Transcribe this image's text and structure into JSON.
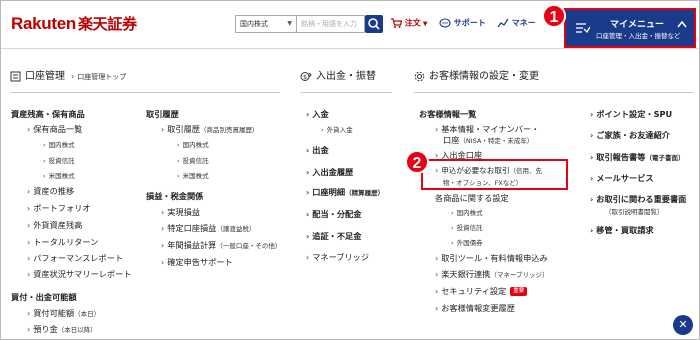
{
  "header": {
    "logo_en": "Rakuten",
    "logo_jp": "楽天証券",
    "market_select": "国内株式",
    "search_placeholder": "銘柄・用語を入力",
    "cart_label": "注文",
    "support_label": "サポート",
    "manual_label": "マネー",
    "mymenu_title": "マイメニュー",
    "mymenu_sub": "口座管理・入出金・振替など"
  },
  "badges": {
    "one": "1",
    "two": "2"
  },
  "sections": {
    "account": {
      "title": "口座管理",
      "sub": "口座管理トップ"
    },
    "deposit": {
      "title": "入出金・振替"
    },
    "customer": {
      "title": "お客様情報の設定・変更"
    }
  },
  "col1": {
    "h1": "資産残高・保有商品",
    "i1": "保有商品一覧",
    "i1a": "国内株式",
    "i1b": "投資信託",
    "i1c": "米国株式",
    "i2": "資産の推移",
    "i3": "ポートフォリオ",
    "i4": "外貨資産残高",
    "i5": "トータルリターン",
    "i6": "パフォーマンスレポート",
    "i7": "資産状況サマリーレポート",
    "h2": "買付・出金可能額",
    "i8": "買付可能額",
    "i8s": "（本日）",
    "i9": "預り金",
    "i9s": "（本日以降）"
  },
  "col2": {
    "h1": "取引履歴",
    "i1": "取引履歴",
    "i1s": "（商品別売買履歴）",
    "i1a": "国内株式",
    "i1b": "投資信託",
    "i1c": "米国株式",
    "h2": "損益・税金関係",
    "i2": "実現損益",
    "i3": "特定口座損益",
    "i3s": "（譲渡益税）",
    "i4": "年間損益計算",
    "i4s": "（一般口座・その他）",
    "i5": "確定申告サポート"
  },
  "col3": {
    "i1": "入金",
    "i1a": "外貨入金",
    "i2": "出金",
    "i3": "入出金履歴",
    "i4": "口座明細",
    "i4s": "（精算履歴）",
    "i5": "配当・分配金",
    "i6": "追証・不足金",
    "i7": "マネーブリッジ"
  },
  "col4": {
    "h1": "お客様情報一覧",
    "i1": "基本情報・マイナンバー・",
    "i1b": "口座",
    "i1s": "（NISA・特定・未成年）",
    "i2": "入出金口座",
    "i3": "申込が必要なお取引",
    "i3s": "（信用、先",
    "i3s2": "物・オプション、FXなど）",
    "i4": "各商品に関する設定",
    "i4a": "国内株式",
    "i4b": "投資信託",
    "i4c": "外国債券",
    "i5": "取引ツール・有料情報申込み",
    "i6": "楽天銀行連携",
    "i6s": "（マネーブリッジ）",
    "i7": "セキュリティ設定",
    "i7tag": "重要",
    "i8": "お客様情報変更履歴"
  },
  "col5": {
    "i1": "ポイント設定・SPU",
    "i2": "ご家族・お友達紹介",
    "i3": "取引報告書等",
    "i3s": "（電子書面）",
    "i4": "メールサービス",
    "i5": "お取引に関わる重要書面",
    "i5s": "（取引説明書閲覧）",
    "i6": "移管・買取請求"
  },
  "colors": {
    "brand": "#bf0000",
    "navy": "#1a3a8c",
    "highlight": "#e60012"
  }
}
